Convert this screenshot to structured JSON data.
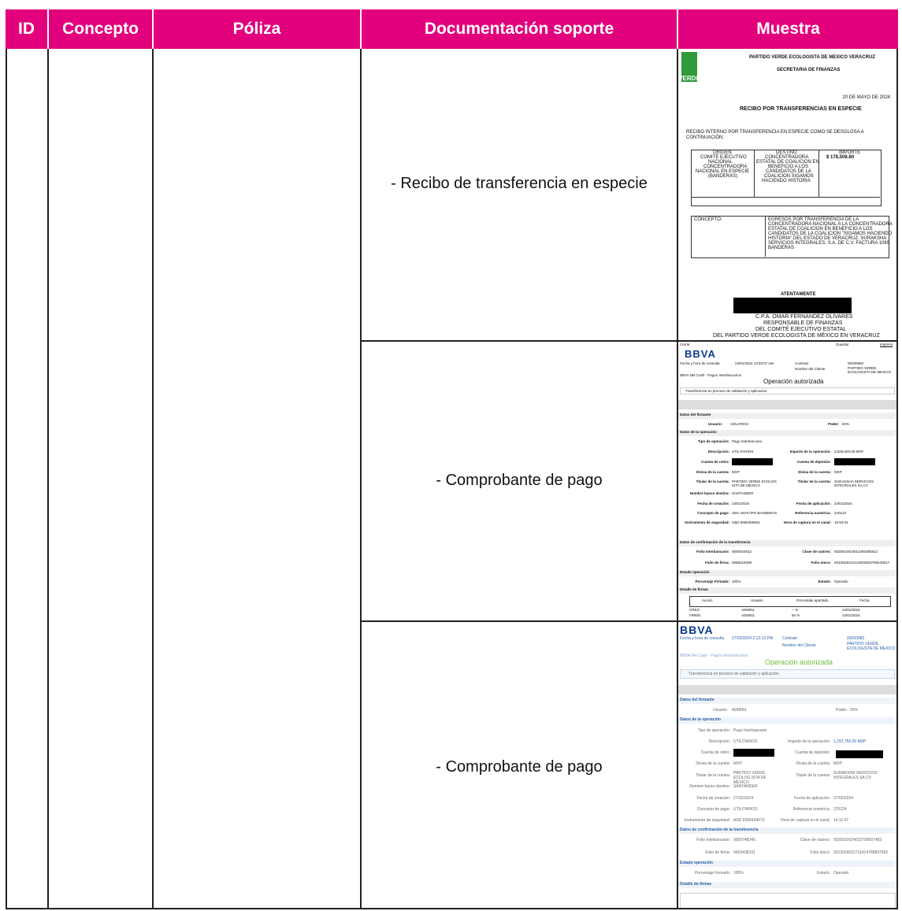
{
  "table": {
    "headers": [
      "ID",
      "Concepto",
      "Póliza",
      "Documentación soporte",
      "Muestra"
    ],
    "rows": [
      {
        "doc": "- Recibo de transferencia en especie"
      },
      {
        "doc": "- Comprobante de pago"
      },
      {
        "doc": "- Comprobante de pago"
      }
    ]
  },
  "colors": {
    "header_bg": "#e3007d",
    "header_text": "#ffffff"
  },
  "sample1": {
    "logo_text": "VERDE",
    "party": "PARTIDO VERDE ECOLOGISTA DE MEXICO VERACRUZ",
    "dept": "SECRETARIA DE FINANZAS",
    "date": "20 DE MAYO DE 2024",
    "title": "RECIBO POR TRANSFERENCIAS EN ESPECIE",
    "intro1": "RECIBO INTERNO POR TRANSFERENCIA EN ESPECIE COMO SE DESGLOSA A",
    "intro2": "CONTINUACIÓN:",
    "col_origen": "ORIGEN",
    "col_destino": "DESTINO",
    "col_importe": "IMPORTE",
    "origen": [
      "COMITÉ EJECUTIVO",
      "NACIONAL",
      "CONCENTRADORA",
      "NACIONAL EN ESPECIE",
      "(BANDERAS)"
    ],
    "destino": [
      "CONCENTRADORA",
      "ESTATAL DE COALICION EN",
      "BENEFICIO A LOS",
      "CANDIDATOS DE LA",
      "COALICION SIGAMOS",
      "HACIENDO HISTORIA"
    ],
    "importe": "$ 178,508.80",
    "concepto_label": "CONCEPTO:",
    "concepto": [
      "EGRESOS POR TRANSFERENCIA DE LA",
      "CONCENTRADORA NACIONAL A LA CONCENTRADORA",
      "ESTATAL DE COALICION EN BENEFICIO A LOS",
      "CANDIDATOS DE LA COALICION \"SIGAMOS HACIENDO",
      "HISTORIA\" DEL ESTADO DE VERACRUZ. SURAKSHA",
      "SERVICIOS INTEGRALES, S.A. DE C.V. FACTURA 1089",
      "BANDERAS"
    ],
    "atentamente": "ATENTAMENTE",
    "sign1": "C.P.A. OMAR FERNANDEZ OLIVARES",
    "sign2": "RESPONSABLE DE FINANZAS",
    "sign3": "DEL COMITÉ EJECUTIVO ESTATAL",
    "sign4": "DEL PARTIDO VERDE ECOLOGISTA DE MÉXICO EN VERACRUZ"
  },
  "sample2": {
    "logo": "BBVA",
    "top_left": "Cerrar",
    "top_mid": "Guardar",
    "top_right": "Imprimir",
    "fecha_label": "Fecha y hora de consulta",
    "fecha": "24/01/2024 10:53:07 AM",
    "contrato_label": "Contrato",
    "contrato": "00250983",
    "cliente_label": "Nombre del Cliente",
    "cliente": "PARTIDO VERDE ECOLOGISTA DE MEXICO",
    "breadcrumb": "BBVA Net Cash - Pagos Interbancarios",
    "status": "Operación autorizada",
    "note": "Transferencia en proceso de validación y aplicación.",
    "sec_firmante": "Datos del firmante",
    "usuario_label": "Usuario:",
    "usuario": "USUARIO2",
    "poder_label": "Poder:",
    "poder": "50%",
    "sec_operacion": "Datos de la operación",
    "fields": [
      [
        "Tipo de operación:",
        "Pago Interbancario",
        "",
        ""
      ],
      [
        "Descripción:",
        "UTILITARIOS",
        "Importe de la operación:",
        "3,826,000.00 MXP"
      ],
      [
        "Cuenta de retiro:",
        "",
        "Cuenta de depósito:",
        ""
      ],
      [
        "Divisa de la cuenta:",
        "MXP",
        "Divisa de la cuenta:",
        "MXP"
      ],
      [
        "Titular de la cuenta:",
        "PARTIDO VERDE ECOLOG ISTA DE MEXICO",
        "Titular de la cuenta:",
        "SURAKSHA SERVICIOS INTEGRALES SA CV"
      ],
      [
        "Nombre banco destino:",
        "SANTANDER",
        "",
        ""
      ],
      [
        "Fecha de creación:",
        "24/01/2024",
        "Fecha de aplicación:",
        "24/01/2024"
      ],
      [
        "Concepto de pago:",
        "25% ANTICIPO BANDERAS",
        "Referencia numérica:",
        "240123"
      ],
      [
        "Instrumento de seguridad:",
        "H&D 6560259934",
        "Hora de captura en el canal:",
        "10:53:04"
      ]
    ],
    "sec_confirm": "Datos de confirmación de la transferencia",
    "confirm": [
      [
        "Folio Interbancario:",
        "0000024812",
        "Clave de rastreo:",
        "0026010024012400380812"
      ],
      [
        "Folio de firma:",
        "0066019339",
        "Folio único:",
        "0010024012410003463798240017"
      ]
    ],
    "sec_estado": "Estado operación",
    "porcentaje_label": "Porcentaje Firmado:",
    "porcentaje": "100%",
    "estado_label": "Estado:",
    "estado": "Operado",
    "sec_firmas": "Detalle de firmas",
    "firmas_headers": [
      "Acción",
      "Usuario",
      "Porcentaje aportado",
      "Fecha"
    ],
    "firmas": [
      [
        "CREO",
        "ADMIN1",
        "-- %",
        "24/01/2024"
      ],
      [
        "FIRMO",
        "ADMIN1",
        "50 %",
        "24/01/2024"
      ]
    ]
  },
  "sample3": {
    "logo": "BBVA",
    "fecha_label": "Fecha y hora de consulta",
    "fecha": "27/02/2024 2:12:12 PM",
    "contrato_label": "Contrato",
    "contrato": "00250983",
    "cliente_label": "Nombre del Cliente",
    "cliente": "PARTIDO VERDE ECOLOGISTA DE MEXICO",
    "breadcrumb": "BBVA Net Cash - Pagos Interbancarios",
    "status": "Operación autorizada",
    "note": "Transferencia en proceso de validación y aplicación.",
    "sec_firmante": "Datos del firmante",
    "usuario_label": "Usuario:",
    "usuario": "ADMIN1",
    "poder_label": "Poder:",
    "poder": "50%",
    "sec_operacion": "Datos de la operación",
    "fields": [
      [
        "Tipo de operación:",
        "Pago Interbancario",
        "",
        ""
      ],
      [
        "Descripción:",
        "UTILITARIOS",
        "Importe de la operación:",
        "1,297,750.00 MXP"
      ],
      [
        "Cuenta de retiro:",
        "",
        "Cuenta de depósito:",
        ""
      ],
      [
        "Divisa de la cuenta:",
        "MXP",
        "Divisa de la cuenta:",
        "MXP"
      ],
      [
        "Titular de la cuenta:",
        "PARTIDO VERDE ECOLOG ISTA DE MEXICO",
        "Titular de la cuenta:",
        "SURAKSHA SERVICIOS INTEGRALES SA CV"
      ],
      [
        "Nombre banco destino:",
        "SANTANDER",
        "",
        ""
      ],
      [
        "Fecha de creación:",
        "27/02/2024",
        "Fecha de aplicación:",
        "27/02/2024"
      ],
      [
        "Concepto de pago:",
        "UTILITARIOS",
        "Referencia numérica:",
        "270224"
      ],
      [
        "Instrumento de seguridad:",
        "ASD 6556494673",
        "Hora de captura en el canal:",
        "14:11:47"
      ]
    ],
    "sec_confirm": "Datos de confirmación de la transferencia",
    "confirm": [
      [
        "Folio Interbancario:",
        "0000748345",
        "Clave de rastreo:",
        "0026010024022700007483"
      ],
      [
        "Folio de firma:",
        "0063438331",
        "Folio único:",
        "0012024022711414768897962"
      ]
    ],
    "sec_estado": "Estado operación",
    "porcentaje_label": "Porcentaje Firmado:",
    "porcentaje": "100%",
    "estado_label": "Estado:",
    "estado": "Operado",
    "sec_firmas": "Detalle de firmas"
  }
}
